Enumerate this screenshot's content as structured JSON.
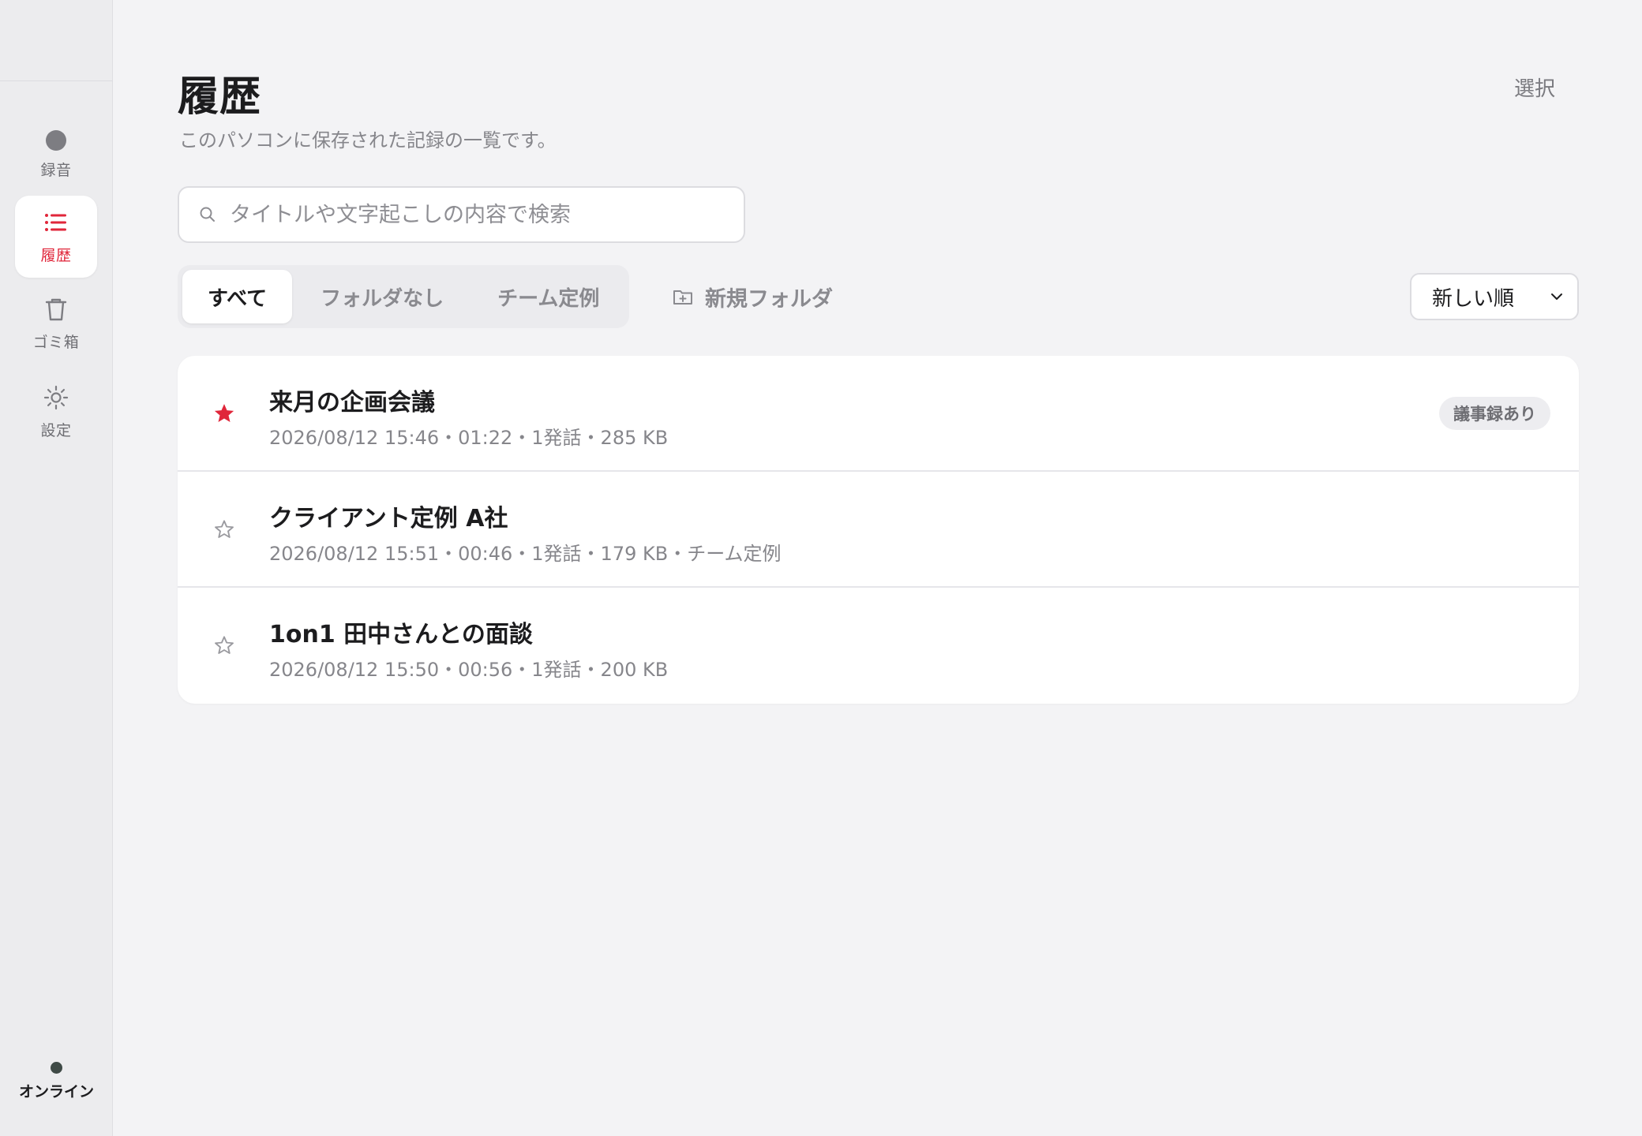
{
  "sidebar": {
    "items": [
      {
        "label": "録音",
        "icon": "record-dot-icon"
      },
      {
        "label": "履歴",
        "icon": "list-icon"
      },
      {
        "label": "ゴミ箱",
        "icon": "trash-icon"
      },
      {
        "label": "設定",
        "icon": "gear-icon"
      }
    ],
    "status_label": "オンライン"
  },
  "header": {
    "title": "履歴",
    "subtitle": "このパソコンに保存された記録の一覧です。",
    "select_label": "選択"
  },
  "search": {
    "placeholder": "タイトルや文字起こしの内容で検索",
    "value": ""
  },
  "tabs": [
    {
      "label": "すべて",
      "active": true
    },
    {
      "label": "フォルダなし",
      "active": false
    },
    {
      "label": "チーム定例",
      "active": false
    }
  ],
  "new_folder_label": "新規フォルダ",
  "sort": {
    "selected": "新しい順"
  },
  "records": [
    {
      "title": "来月の企画会議",
      "meta": "2026/08/12 15:46・01:22・1発話・285 KB",
      "starred": true,
      "badge": "議事録あり"
    },
    {
      "title": "クライアント定例 A社",
      "meta": "2026/08/12 15:51・00:46・1発話・179 KB・チーム定例",
      "starred": false,
      "badge": ""
    },
    {
      "title": "1on1 田中さんとの面談",
      "meta": "2026/08/12 15:50・00:56・1発話・200 KB",
      "starred": false,
      "badge": ""
    }
  ],
  "colors": {
    "accent": "#e0263a",
    "background": "#f3f3f5",
    "sidebar": "#ececee",
    "muted_text": "#86868b"
  }
}
